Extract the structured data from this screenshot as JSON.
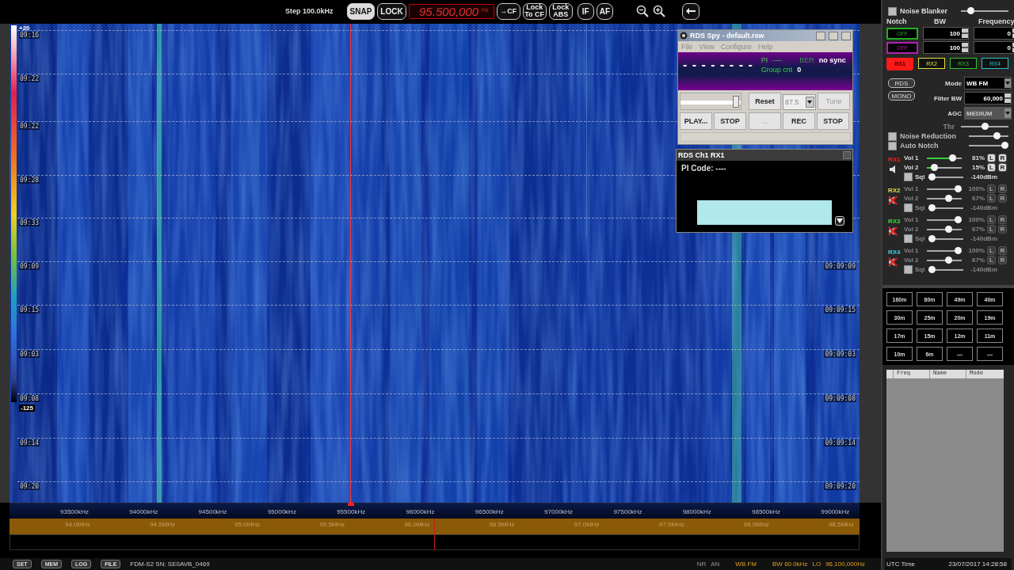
{
  "toolbar": {
    "step": "Step 100.0kHz",
    "toggles": [
      {
        "label": "SNAP",
        "selected": true
      },
      {
        "label": "LOCK",
        "selected": false
      }
    ],
    "frequency": "95.500,000",
    "frequency_unit": "Hz",
    "buttons": [
      "→CF",
      "Lock To CF",
      "Lock ABS"
    ],
    "display_buttons": [
      "IF",
      "AF"
    ]
  },
  "waterfall": {
    "scale_max": "+20",
    "scale_min": "-125",
    "rows": [
      {
        "left": "09:16"
      },
      {
        "left": "09:22"
      },
      {
        "left": "09:22"
      },
      {
        "left": "09:28"
      },
      {
        "left": "09:33"
      },
      {
        "left": "09:09",
        "right": "09:09:09"
      },
      {
        "left": "09:15",
        "right": "09:09:15"
      },
      {
        "left": "09:03",
        "right": "09:09:03"
      },
      {
        "left": "09:08",
        "right": "09:09:08"
      },
      {
        "left": "09:14",
        "right": "09:09:14"
      },
      {
        "left": "09:20",
        "right": "09:09:20"
      }
    ],
    "freq_labels": [
      "93500kHz",
      "94000kHz",
      "94500kHz",
      "95000kHz",
      "95500kHz",
      "96000kHz",
      "96500kHz",
      "97000kHz",
      "97500kHz",
      "98000kHz",
      "98500kHz",
      "99000kHz"
    ],
    "band_labels": [
      "94.0MHz",
      "94.5MHz",
      "95.0MHz",
      "95.5MHz",
      "96.0MHz",
      "96.5MHz",
      "97.0MHz",
      "97.5MHz",
      "98.0MHz",
      "98.5MHz"
    ]
  },
  "rds_spy": {
    "title": "RDS Spy - default.rsw",
    "menu": [
      "File",
      "View",
      "Configure",
      "Help"
    ],
    "ps": "- - - - - - - -",
    "pi_label": "PI",
    "pi": "----",
    "ber_label": "BER",
    "sync": "no sync",
    "group_label": "Group cnt",
    "group_count": "0",
    "slider": {
      "level": 1
    },
    "reset": "Reset",
    "frequency": "87.5",
    "tune": {
      "label": "Tune",
      "disabled": true
    },
    "buttons": [
      {
        "label": "PLAY...",
        "disabled": false
      },
      {
        "label": "STOP",
        "disabled": false
      },
      {
        "label": "...",
        "disabled": true
      },
      {
        "label": "REC",
        "disabled": false
      },
      {
        "label": "STOP",
        "disabled": false
      }
    ]
  },
  "rds_channel": {
    "title": "RDS Ch1 RX1",
    "pi_code": "PI Code: ----"
  },
  "panel": {
    "noise_blanker": {
      "label": "Noise Blanker",
      "checked": false,
      "level": 0.15
    },
    "notch_headers": [
      "Notch",
      "BW",
      "Frequency"
    ],
    "notches": [
      {
        "label": "OFF",
        "color": "#22b022",
        "bw": "100",
        "frequency": "0"
      },
      {
        "label": "OFF",
        "color": "#b022b0",
        "bw": "100",
        "frequency": "0"
      }
    ],
    "receiver_tabs": [
      {
        "label": "RX1",
        "color": "#ff1a1a",
        "selected": true
      },
      {
        "label": "RX2",
        "color": "#e0e040",
        "selected": false
      },
      {
        "label": "RX3",
        "color": "#30c030",
        "selected": false
      },
      {
        "label": "RX4",
        "color": "#30c0c0",
        "selected": false
      }
    ],
    "rds_button": "RDS",
    "mono_button": "MONO",
    "mode_label": "Mode",
    "mode": "WB FM",
    "filter_label": "Filter BW",
    "filter": "60,000",
    "agc_label": "AGC",
    "agc": "MEDIUM",
    "thr": {
      "label": "Thr",
      "level": 0.5
    },
    "noise_reduction": {
      "label": "Noise Reduction",
      "checked": false,
      "level": 0.75
    },
    "auto_notch": {
      "label": "Auto Notch",
      "checked": false,
      "level": 1
    },
    "receivers": [
      {
        "name": "RX1",
        "color": "#ff1a1a",
        "active": true,
        "muted": false,
        "vol1": {
          "label": "Vol 1",
          "level": 0.81,
          "reading": "81%",
          "channels": [
            "L",
            "R"
          ]
        },
        "vol2": {
          "label": "Vol 2",
          "level": 0.15,
          "reading": "15%",
          "channels": [
            "L",
            "R"
          ]
        },
        "sql": {
          "label": "Sql",
          "checked": false,
          "level": 0,
          "reading": "-140dBm"
        }
      },
      {
        "name": "RX2",
        "color": "#e0e040",
        "active": false,
        "muted": true,
        "vol1": {
          "label": "Vol 1",
          "level": 1,
          "reading": "100%",
          "channels": [
            "L",
            "R"
          ]
        },
        "vol2": {
          "label": "Vol 2",
          "level": 0.67,
          "reading": "67%",
          "channels": [
            "L",
            "R"
          ]
        },
        "sql": {
          "label": "Sql",
          "checked": false,
          "level": 0,
          "reading": "-140dBm"
        }
      },
      {
        "name": "RX3",
        "color": "#30e030",
        "active": false,
        "muted": true,
        "vol1": {
          "label": "Vol 1",
          "level": 1,
          "reading": "100%",
          "channels": [
            "L",
            "R"
          ]
        },
        "vol2": {
          "label": "Vol 2",
          "level": 0.67,
          "reading": "67%",
          "channels": [
            "L",
            "R"
          ]
        },
        "sql": {
          "label": "Sql",
          "checked": false,
          "level": 0,
          "reading": "-140dBm"
        }
      },
      {
        "name": "RX4",
        "color": "#30d0e0",
        "active": false,
        "muted": true,
        "vol1": {
          "label": "Vol 1",
          "level": 1,
          "reading": "100%",
          "channels": [
            "L",
            "R"
          ]
        },
        "vol2": {
          "label": "Vol 2",
          "level": 0.67,
          "reading": "67%",
          "channels": [
            "L",
            "R"
          ]
        },
        "sql": {
          "label": "Sql",
          "checked": false,
          "level": 0,
          "reading": "-140dBm"
        }
      }
    ],
    "bands": [
      "160m",
      "80m",
      "49m",
      "40m",
      "30m",
      "25m",
      "20m",
      "19m",
      "17m",
      "15m",
      "12m",
      "11m",
      "10m",
      "6m",
      "—",
      "—"
    ],
    "memory_columns": [
      "Freq",
      "Name",
      "Mode"
    ],
    "utc_label": "UTC Time",
    "datetime": "23/07/2017 14:28:58"
  },
  "status_bar": {
    "buttons": [
      "SET",
      "MEM",
      "LOG",
      "FILE"
    ],
    "device": "FDM-S2 SN: SE0AVB_0469",
    "indicators": [
      "NR",
      "AN"
    ],
    "mode": "WB FM",
    "bandwidth": "BW 60.0kHz",
    "lo_label": "LO",
    "lo": "96,100,000Hz"
  }
}
